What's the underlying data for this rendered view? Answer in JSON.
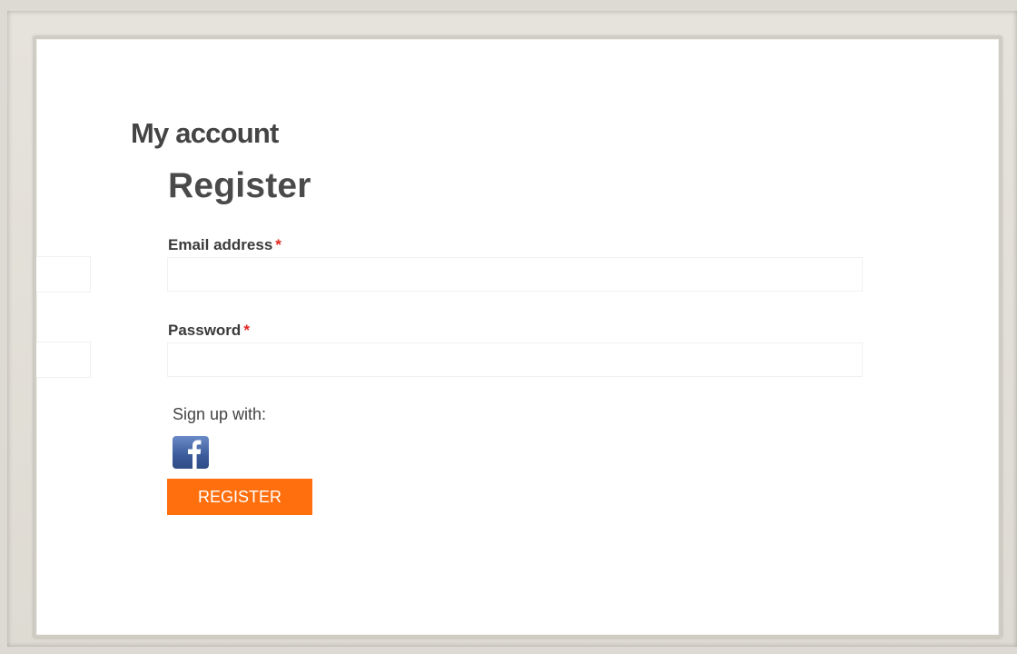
{
  "page": {
    "title": "My account"
  },
  "register": {
    "heading": "Register",
    "email_label": "Email address",
    "password_label": "Password",
    "required_marker": "*",
    "email_value": "",
    "password_value": "",
    "signup_with_label": "Sign up with:",
    "social_icon": "facebook-icon",
    "button_label": "REGISTER"
  },
  "colors": {
    "accent": "#ff6f0e",
    "required": "#e2261f",
    "facebook": "#3b5998"
  }
}
